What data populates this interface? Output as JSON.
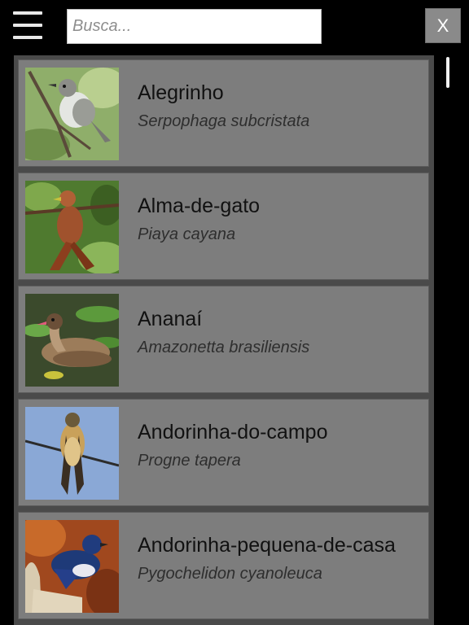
{
  "header": {
    "menu_icon": "hamburger-menu-icon",
    "search": {
      "placeholder": "Busca...",
      "value": ""
    },
    "clear_label": "X"
  },
  "birds": [
    {
      "common_name": "Alegrinho",
      "scientific_name": "Serpophaga subcristata"
    },
    {
      "common_name": "Alma-de-gato",
      "scientific_name": "Piaya cayana"
    },
    {
      "common_name": "Ananaí",
      "scientific_name": "Amazonetta brasiliensis"
    },
    {
      "common_name": "Andorinha-do-campo",
      "scientific_name": "Progne tapera"
    },
    {
      "common_name": "Andorinha-pequena-de-casa",
      "scientific_name": "Pygochelidon cyanoleuca"
    }
  ]
}
